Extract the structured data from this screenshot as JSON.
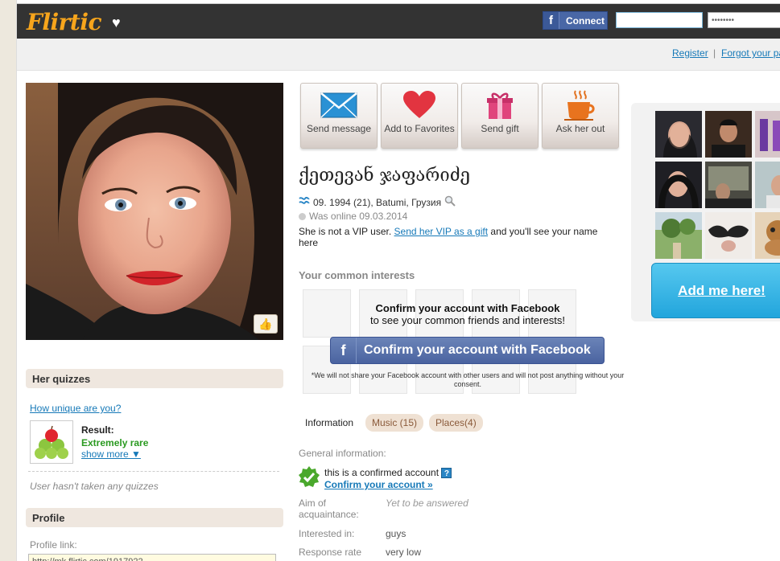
{
  "header": {
    "logo": "Flirtic",
    "logo_heart": "♥",
    "fb_connect_label": "Connect",
    "fb_glyph": "f",
    "email_value": "",
    "password_value": "••••••••"
  },
  "subbar": {
    "register_label": "Register",
    "separator": "|",
    "forgot_label": "Forgot your pa"
  },
  "actions": [
    {
      "label": "Send message",
      "icon": "envelope-icon"
    },
    {
      "label": "Add to Favorites",
      "icon": "heart-icon"
    },
    {
      "label": "Send gift",
      "icon": "gift-icon"
    },
    {
      "label": "Ask her out",
      "icon": "coffee-cup-icon"
    }
  ],
  "profile": {
    "name": "ქეთევან ჯაფარიძე",
    "birth_line": "09. 1994 (21), Batumi, Грузия",
    "online_line": "Was online 09.03.2014",
    "vip_prefix": "She is not a VIP user. ",
    "vip_link": "Send her VIP as a gift",
    "vip_suffix": " and you'll see your name here"
  },
  "common_interests": {
    "title": "Your common interests",
    "overlay_title": "Confirm your account with Facebook",
    "overlay_sub": "to see your common friends and interests!",
    "button_label": "Confirm your account with Facebook",
    "note": "*We will not share your Facebook account with other users and will not post anything without your consent."
  },
  "tabs": [
    {
      "label": "Information",
      "active": true
    },
    {
      "label": "Music (15)",
      "active": false
    },
    {
      "label": "Places(4)",
      "active": false
    }
  ],
  "info": {
    "general_label": "General information:",
    "confirmed_text": "this is a confirmed account",
    "qmark": "?",
    "confirm_link": "Confirm your account »",
    "aim_label": "Aim of acquaintance:",
    "aim_value": "Yet to be answered",
    "interested_label": "Interested in:",
    "interested_value": "guys",
    "response_label": "Response rate",
    "response_value": "very low"
  },
  "quizzes": {
    "title": "Her quizzes",
    "link": "How unique are you?",
    "result_label": "Result:",
    "result_value": "Extremely rare",
    "show_more": "show more ▼",
    "empty_note": "User hasn't taken any quizzes"
  },
  "profile_panel": {
    "title": "Profile",
    "link_label": "Profile link:",
    "link_value": "http://mk.flirtic.com/1917922"
  },
  "right": {
    "add_me_label": "Add me here!"
  },
  "colors": {
    "brand_orange": "#f7a51c",
    "link_blue": "#1679b8",
    "facebook_blue": "#4967a6",
    "cyan_cta": "#22a5dc"
  }
}
